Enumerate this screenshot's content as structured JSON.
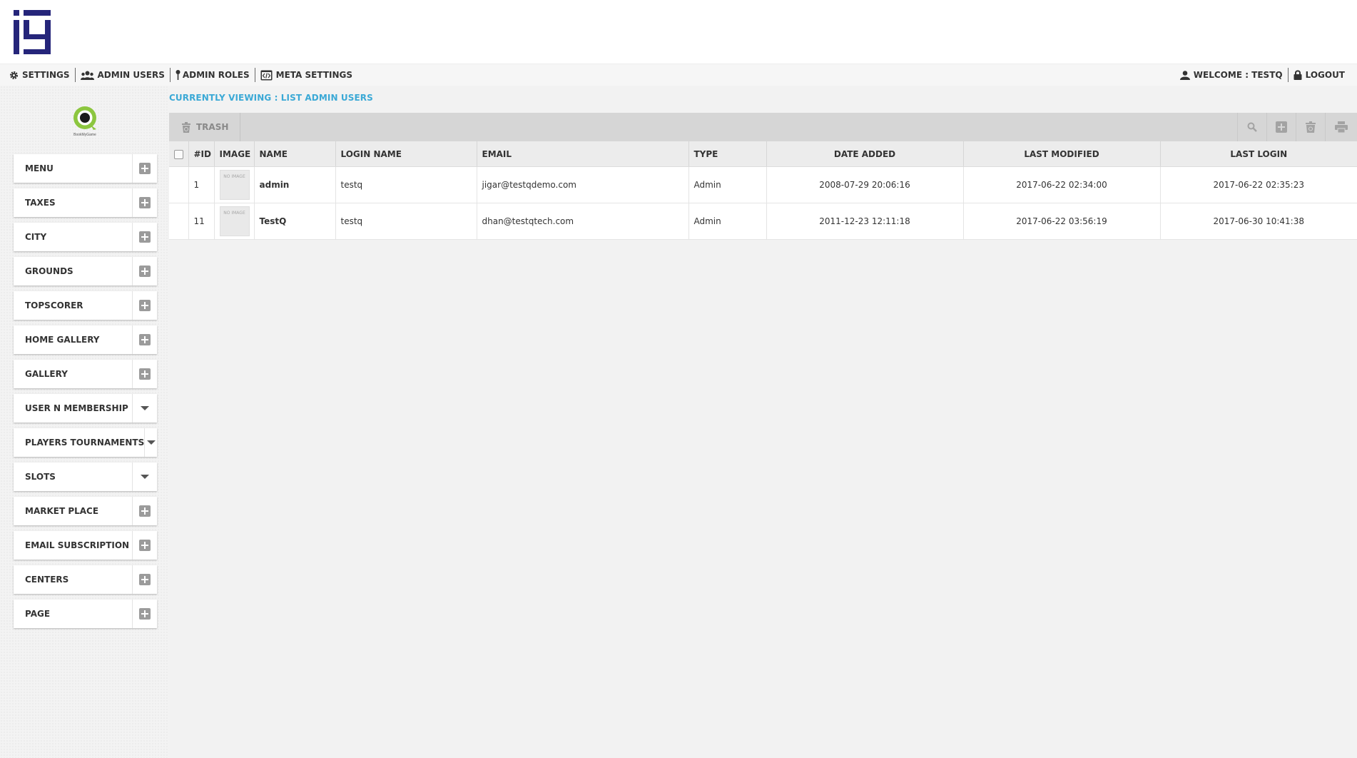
{
  "brand": {
    "logo_icon": "iq-logo-icon",
    "color": "#25257a",
    "sidebar_logo_icon": "bookmygame-logo-icon",
    "sidebar_logo_text": "BookMyGame",
    "accent_green": "#8cc63f"
  },
  "topnav": {
    "items": [
      {
        "label": "SETTINGS",
        "icon": "gear-icon"
      },
      {
        "label": "ADMIN USERS",
        "icon": "users-icon"
      },
      {
        "label": "ADMIN ROLES",
        "icon": "pin-icon"
      },
      {
        "label": "META SETTINGS",
        "icon": "code-icon"
      }
    ],
    "welcome": "WELCOME : TESTQ",
    "logout": "LOGOUT"
  },
  "breadcrumb": "CURRENTLY VIEWING : LIST ADMIN USERS",
  "toolbar": {
    "trash_label": "TRASH",
    "tools": [
      "search-icon",
      "add-icon",
      "delete-icon",
      "print-icon"
    ]
  },
  "sidebar": {
    "items": [
      {
        "label": "MENU",
        "control": "plus"
      },
      {
        "label": "TAXES",
        "control": "plus"
      },
      {
        "label": "CITY",
        "control": "plus"
      },
      {
        "label": "GROUNDS",
        "control": "plus"
      },
      {
        "label": "TOPSCORER",
        "control": "plus"
      },
      {
        "label": "HOME GALLERY",
        "control": "plus"
      },
      {
        "label": "GALLERY",
        "control": "plus"
      },
      {
        "label": "USER N MEMBERSHIP",
        "control": "caret"
      },
      {
        "label": "PLAYERS TOURNAMENTS",
        "control": "caret"
      },
      {
        "label": "SLOTS",
        "control": "caret"
      },
      {
        "label": "MARKET PLACE",
        "control": "plus"
      },
      {
        "label": "EMAIL SUBSCRIPTION",
        "control": "plus"
      },
      {
        "label": "CENTERS",
        "control": "plus"
      },
      {
        "label": "PAGE",
        "control": "plus"
      }
    ]
  },
  "table": {
    "headers": {
      "id": "#ID",
      "image": "IMAGE",
      "name": "NAME",
      "login": "LOGIN NAME",
      "email": "EMAIL",
      "type": "TYPE",
      "date_added": "DATE ADDED",
      "last_modified": "LAST MODIFIED",
      "last_login": "LAST LOGIN"
    },
    "no_image": "NO IMAGE",
    "rows": [
      {
        "id": "1",
        "name": "admin",
        "login": "testq",
        "email": "jigar@testqdemo.com",
        "type": "Admin",
        "date_added": "2008-07-29 20:06:16",
        "last_modified": "2017-06-22 02:34:00",
        "last_login": "2017-06-22 02:35:23"
      },
      {
        "id": "11",
        "name": "TestQ",
        "login": "testq",
        "email": "dhan@testqtech.com",
        "type": "Admin",
        "date_added": "2011-12-23 12:11:18",
        "last_modified": "2017-06-22 03:56:19",
        "last_login": "2017-06-30 10:41:38"
      }
    ]
  }
}
